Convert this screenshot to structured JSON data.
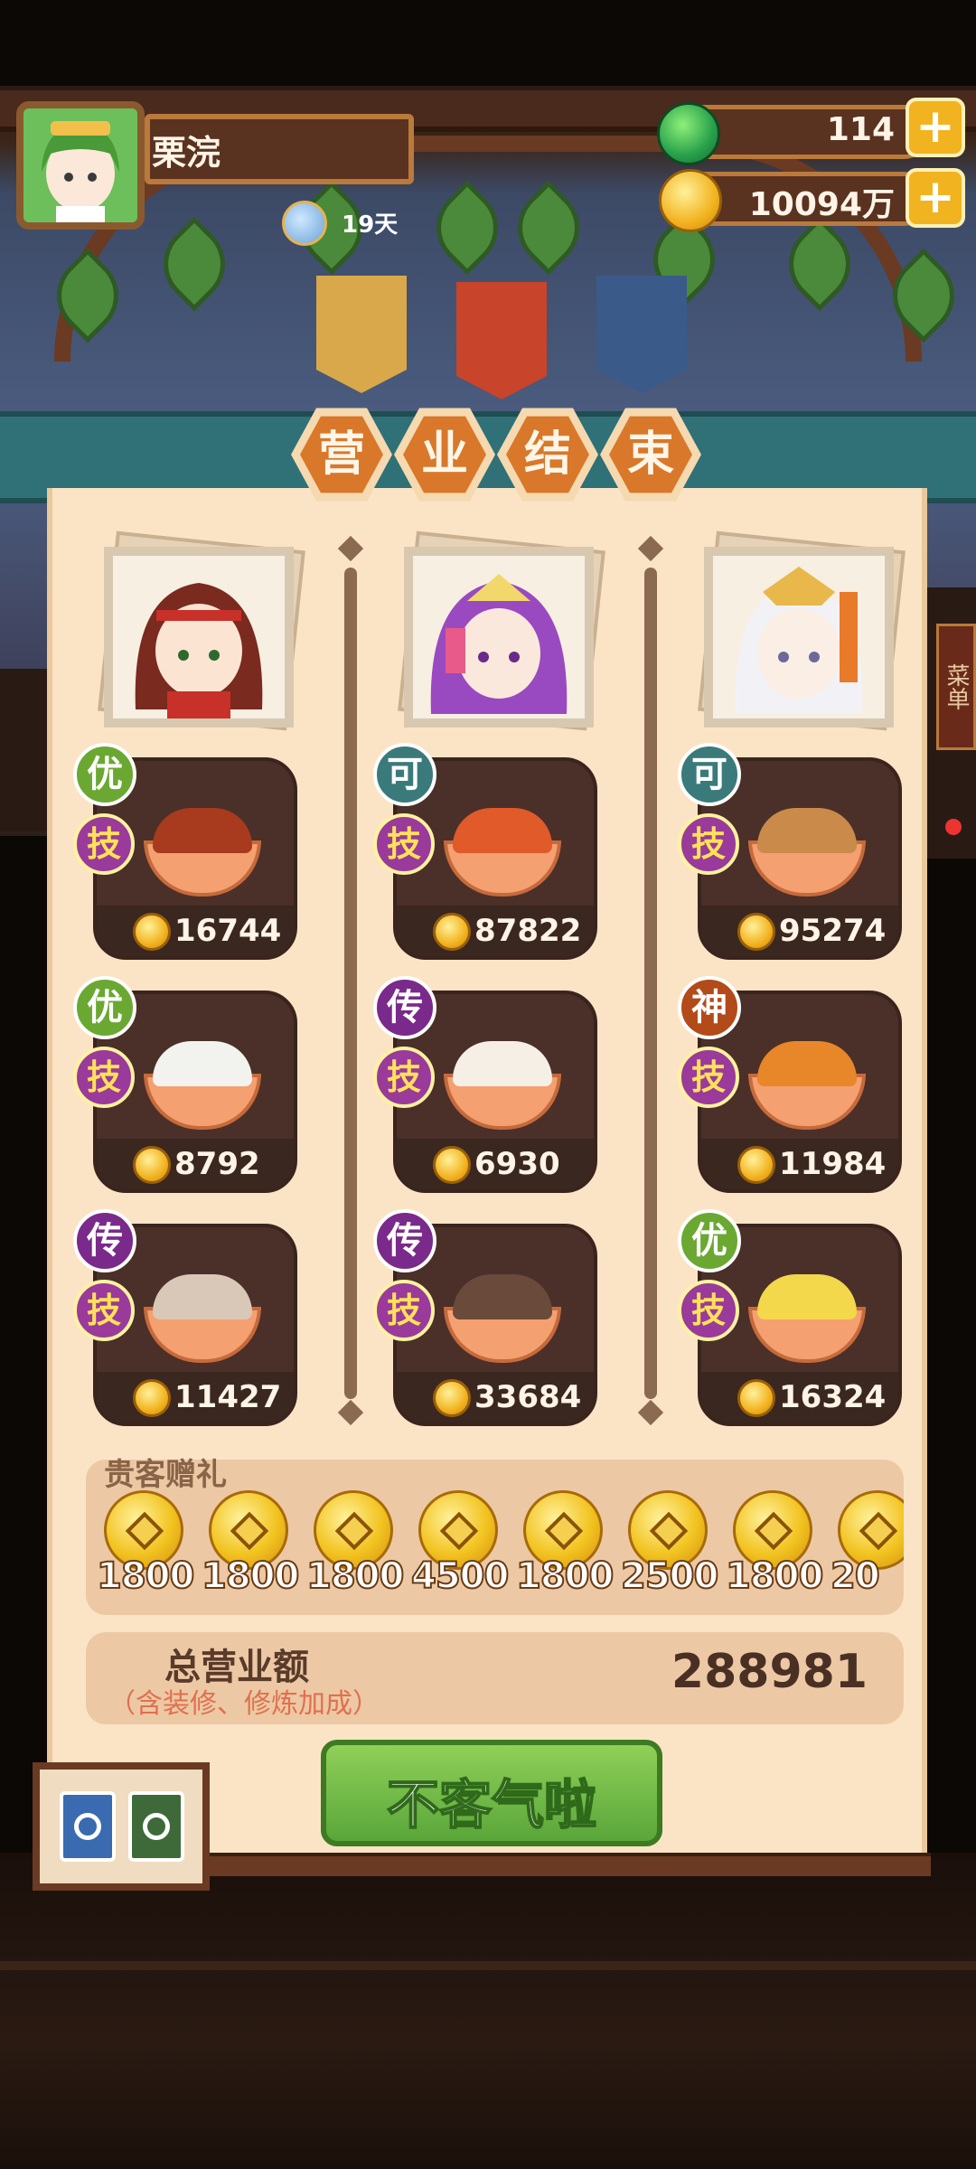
{
  "player": {
    "name": "栗浣",
    "days": "19天"
  },
  "resources": {
    "gems": "114",
    "coins": "10094万"
  },
  "title_chars": [
    "营",
    "业",
    "结",
    "束"
  ],
  "columns": [
    {
      "dishes": [
        {
          "grade": "优",
          "grade_color": "#6aa832",
          "skill": "技",
          "price": "16744",
          "food_color": "#a83a1e"
        },
        {
          "grade": "优",
          "grade_color": "#6aa832",
          "skill": "技",
          "price": "8792",
          "food_color": "#f2f2ee"
        },
        {
          "grade": "传",
          "grade_color": "#7a2a8a",
          "skill": "技",
          "price": "11427",
          "food_color": "#d9c8b8"
        }
      ]
    },
    {
      "dishes": [
        {
          "grade": "可",
          "grade_color": "#3a7a7a",
          "skill": "技",
          "price": "87822",
          "food_color": "#e05a2a"
        },
        {
          "grade": "传",
          "grade_color": "#7a2a8a",
          "skill": "技",
          "price": "6930",
          "food_color": "#f6efe6"
        },
        {
          "grade": "传",
          "grade_color": "#7a2a8a",
          "skill": "技",
          "price": "33684",
          "food_color": "#6a4a3a"
        }
      ]
    },
    {
      "dishes": [
        {
          "grade": "可",
          "grade_color": "#3a7a7a",
          "skill": "技",
          "price": "95274",
          "food_color": "#c98a4a"
        },
        {
          "grade": "神",
          "grade_color": "#b24a1a",
          "skill": "技",
          "price": "11984",
          "food_color": "#e8862a"
        },
        {
          "grade": "优",
          "grade_color": "#6aa832",
          "skill": "技",
          "price": "16324",
          "food_color": "#f2d84a"
        }
      ]
    }
  ],
  "gifts": {
    "title": "贵客赠礼",
    "values": [
      "1800",
      "1800",
      "1800",
      "4500",
      "1800",
      "2500",
      "1800",
      "20"
    ]
  },
  "total": {
    "label": "总营业额",
    "note": "（含装修、修炼加成）",
    "value": "288981"
  },
  "confirm_label": "不客气啦",
  "side_menu_label": "菜单"
}
